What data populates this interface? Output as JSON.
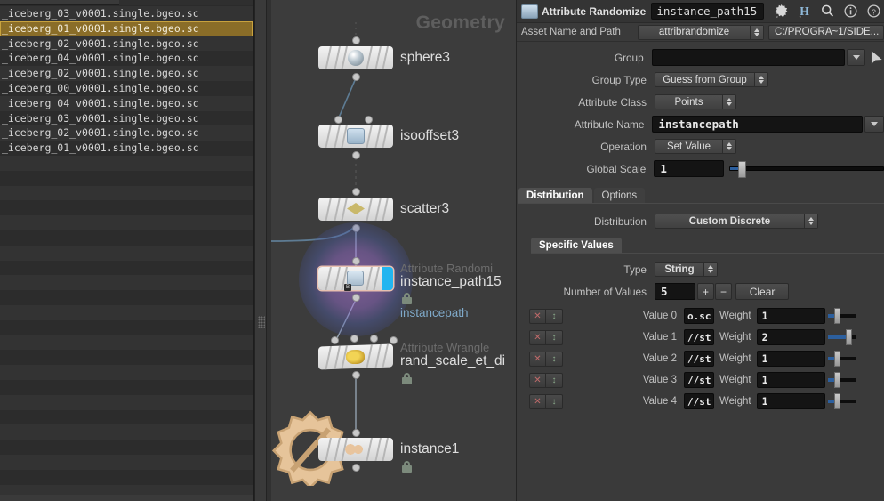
{
  "file_list": {
    "items": [
      "_iceberg_03_v0001.single.bgeo.sc",
      "_iceberg_01_v0001.single.bgeo.sc",
      "_iceberg_02_v0001.single.bgeo.sc",
      "_iceberg_04_v0001.single.bgeo.sc",
      "_iceberg_02_v0001.single.bgeo.sc",
      "_iceberg_00_v0001.single.bgeo.sc",
      "_iceberg_04_v0001.single.bgeo.sc",
      "_iceberg_03_v0001.single.bgeo.sc",
      "_iceberg_02_v0001.single.bgeo.sc",
      "_iceberg_01_v0001.single.bgeo.sc"
    ],
    "selected_index": 1,
    "selected_color": "#8a6d28"
  },
  "graph": {
    "title": "Geometry",
    "nodes": [
      {
        "name": "sphere3",
        "type": "",
        "sub": "",
        "icon": "sphere-icon",
        "locked": false
      },
      {
        "name": "isooffset3",
        "type": "",
        "sub": "",
        "icon": "isooffset-icon",
        "locked": false
      },
      {
        "name": "scatter3",
        "type": "",
        "sub": "",
        "icon": "scatter-icon",
        "locked": false
      },
      {
        "name": "instance_path15",
        "type": "Attribute Randomi",
        "sub": "instancepath",
        "icon": "attribrandomize-icon",
        "locked": true
      },
      {
        "name": "rand_scale_et_di",
        "type": "Attribute Wrangle",
        "sub": "",
        "icon": "wrangle-icon",
        "locked": true
      },
      {
        "name": "instance1",
        "type": "",
        "sub": "",
        "icon": "instance-icon",
        "locked": true
      }
    ]
  },
  "params": {
    "header": {
      "op_icon": "attribrandomize-icon",
      "op_title": "Attribute Randomize",
      "op_name": "instance_path15",
      "icons": [
        "gear-icon",
        "houdini-h-icon",
        "search-icon",
        "info-icon",
        "help-icon"
      ]
    },
    "asset_row": {
      "label": "Asset Name and Path",
      "asset_name": "attribrandomize",
      "asset_path": "C:/PROGRA~1/SIDE..."
    },
    "rows": [
      {
        "label": "Group",
        "kind": "text-dropdown",
        "value": ""
      },
      {
        "label": "Group Type",
        "kind": "menu",
        "value": "Guess from Group"
      },
      {
        "label": "Attribute Class",
        "kind": "menu",
        "value": "Points"
      },
      {
        "label": "Attribute Name",
        "kind": "text-dropdown",
        "value": "instancepath"
      },
      {
        "label": "Operation",
        "kind": "menu",
        "value": "Set Value"
      },
      {
        "label": "Global Scale",
        "kind": "slider",
        "value": "1",
        "slider_pct": 7
      }
    ],
    "tabs": [
      {
        "label": "Distribution",
        "active": true
      },
      {
        "label": "Options",
        "active": false
      }
    ],
    "distribution": {
      "label": "Distribution",
      "value": "Custom Discrete"
    },
    "specific_values": {
      "subtab": "Specific Values",
      "type_label": "Type",
      "type_value": "String",
      "count_label": "Number of Values",
      "count_value": "5",
      "plus_label": "+",
      "minus_label": "−",
      "clear_label": "Clear",
      "weight_label": "Weight",
      "rows": [
        {
          "label": "Value 0",
          "value": "o.sc",
          "weight": "1",
          "weight_pct": 34,
          "remove": "✕",
          "move": "↕"
        },
        {
          "label": "Value 1",
          "value": "//st",
          "weight": "2",
          "weight_pct": 72,
          "remove": "✕",
          "move": "↕"
        },
        {
          "label": "Value 2",
          "value": "//st",
          "weight": "1",
          "weight_pct": 34,
          "remove": "✕",
          "move": "↕"
        },
        {
          "label": "Value 3",
          "value": "//st",
          "weight": "1",
          "weight_pct": 34,
          "remove": "✕",
          "move": "↕"
        },
        {
          "label": "Value 4",
          "value": "//st",
          "weight": "1",
          "weight_pct": 34,
          "remove": "✕",
          "move": "↕"
        }
      ]
    }
  },
  "colors": {
    "accent_blue": "#2c5f9e",
    "flag_blue": "#22b5f0",
    "panel_bg": "#3a3a3a",
    "field_bg": "#141414"
  }
}
